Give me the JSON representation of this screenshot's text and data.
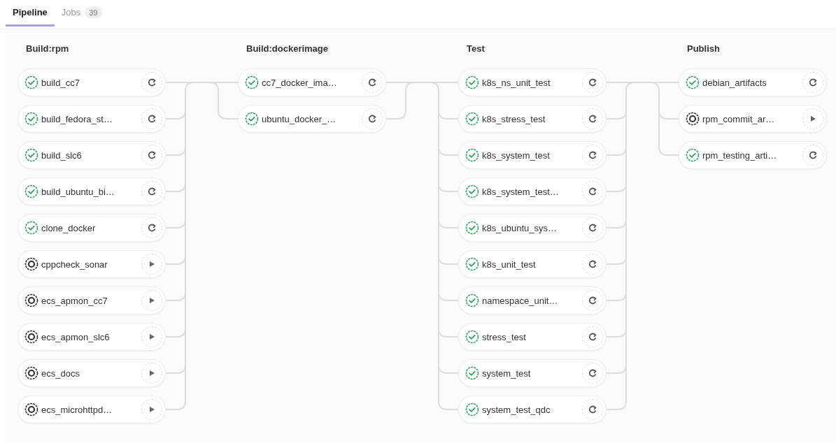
{
  "tabs": [
    {
      "label": "Pipeline",
      "selected": true
    },
    {
      "label": "Jobs",
      "count": "39",
      "selected": false
    }
  ],
  "stages": [
    {
      "title": "Build:rpm",
      "jobs": [
        {
          "name": "build_cc7",
          "kind": "success"
        },
        {
          "name": "build_fedora_st…",
          "kind": "success"
        },
        {
          "name": "build_slc6",
          "kind": "success"
        },
        {
          "name": "build_ubuntu_bi…",
          "kind": "success"
        },
        {
          "name": "clone_docker",
          "kind": "success"
        },
        {
          "name": "cppcheck_sonar",
          "kind": "manual"
        },
        {
          "name": "ecs_apmon_cc7",
          "kind": "manual"
        },
        {
          "name": "ecs_apmon_slc6",
          "kind": "manual"
        },
        {
          "name": "ecs_docs",
          "kind": "manual"
        },
        {
          "name": "ecs_microhttpd…",
          "kind": "manual"
        }
      ]
    },
    {
      "title": "Build:dockerimage",
      "jobs": [
        {
          "name": "cc7_docker_ima…",
          "kind": "success"
        },
        {
          "name": "ubuntu_docker_…",
          "kind": "success"
        }
      ]
    },
    {
      "title": "Test",
      "jobs": [
        {
          "name": "k8s_ns_unit_test",
          "kind": "success"
        },
        {
          "name": "k8s_stress_test",
          "kind": "success"
        },
        {
          "name": "k8s_system_test",
          "kind": "success"
        },
        {
          "name": "k8s_system_test…",
          "kind": "success"
        },
        {
          "name": "k8s_ubuntu_sys…",
          "kind": "success"
        },
        {
          "name": "k8s_unit_test",
          "kind": "success"
        },
        {
          "name": "namespace_unit…",
          "kind": "success"
        },
        {
          "name": "stress_test",
          "kind": "success"
        },
        {
          "name": "system_test",
          "kind": "success"
        },
        {
          "name": "system_test_qdc",
          "kind": "success"
        }
      ]
    },
    {
      "title": "Publish",
      "jobs": [
        {
          "name": "debian_artifacts",
          "kind": "success"
        },
        {
          "name": "rpm_commit_ar…",
          "kind": "manual"
        },
        {
          "name": "rpm_testing_arti…",
          "kind": "success"
        }
      ]
    }
  ]
}
